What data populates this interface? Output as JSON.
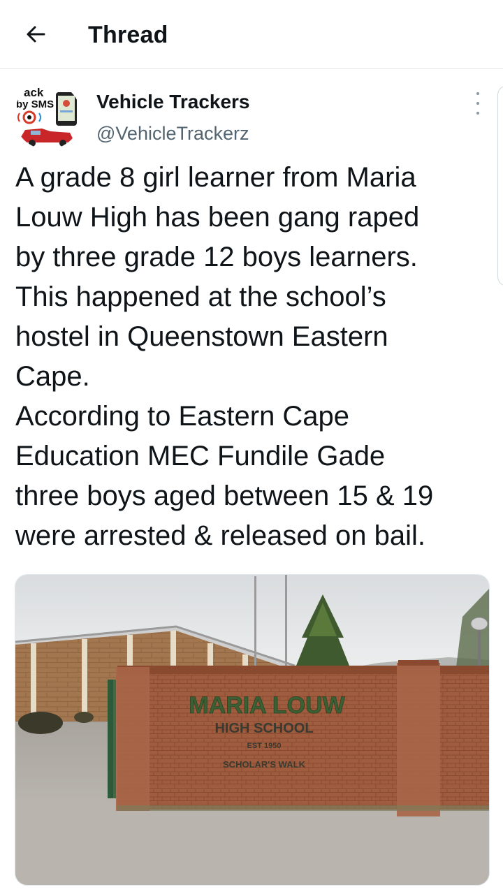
{
  "header": {
    "title": "Thread",
    "back_icon": "arrow-left-icon"
  },
  "tweet": {
    "author_name": "Vehicle Trackers",
    "author_handle": "@VehicleTrackerz",
    "avatar": {
      "text_line1": "ack",
      "text_line2": "by SMS"
    },
    "text": "A grade 8 girl learner from Maria\nLouw High has been gang raped\nby three grade 12 boys learners.\nThis happened at the school’s\nhostel in Queenstown Eastern\nCape.\nAccording to Eastern Cape\nEducation MEC Fundile Gade\nthree boys aged between 15 & 19\nwere arrested & released on bail.",
    "more_icon": "more-vertical-icon"
  },
  "media": {
    "sign_line1": "MARIA LOUW",
    "sign_line2": "HIGH SCHOOL",
    "sign_line3": "EST 1950",
    "sign_line4": "SCHOLAR'S WALK"
  },
  "colors": {
    "text": "#0f1419",
    "secondary": "#536471",
    "divider": "#e6e6e6",
    "brick": "#9e5a3c",
    "sky": "#e3e6e7"
  }
}
